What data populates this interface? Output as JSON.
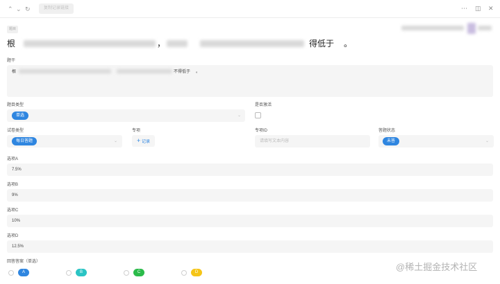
{
  "toolbar": {
    "back_icon": "chevron-up",
    "forward_icon": "chevron-down",
    "refresh_icon": "refresh",
    "copy_label": "复制记录链接",
    "more_icon": "ellipsis",
    "panel_icon": "side-panel",
    "close_icon": "close"
  },
  "record": {
    "tag_label": "题目",
    "title_start": "根",
    "title_mid": "，",
    "title_end": "得低于",
    "title_tail": "。"
  },
  "stem": {
    "label": "题干",
    "text_start": "根",
    "text_end": "不得低于",
    "text_tail": "。"
  },
  "question_type": {
    "label": "题目类型",
    "value": "单选"
  },
  "is_active": {
    "label": "是否激活",
    "checked": false
  },
  "paper_type": {
    "label": "试卷类型",
    "value": "每日答题"
  },
  "topic": {
    "label": "专项",
    "add_label": "记录"
  },
  "topic_id": {
    "label": "专项ID",
    "placeholder": "请填写文本内容"
  },
  "answer_status": {
    "label": "答题状态",
    "value": "未答"
  },
  "options": [
    {
      "label": "选项A",
      "value": "7.5%"
    },
    {
      "label": "选项B",
      "value": "9%"
    },
    {
      "label": "选项C",
      "value": "10%"
    },
    {
      "label": "选项D",
      "value": "12.5%"
    }
  ],
  "answer": {
    "label": "回答答案（单选）",
    "choices": [
      {
        "letter": "A",
        "color": "#2f86e0"
      },
      {
        "letter": "B",
        "color": "#2bc4c4"
      },
      {
        "letter": "C",
        "color": "#2bbb4a"
      },
      {
        "letter": "D",
        "color": "#f5c518"
      }
    ]
  },
  "watermark": "@稀土掘金技术社区",
  "colors": {
    "accent": "#2f86e0",
    "field_bg": "#f5f5f5"
  }
}
